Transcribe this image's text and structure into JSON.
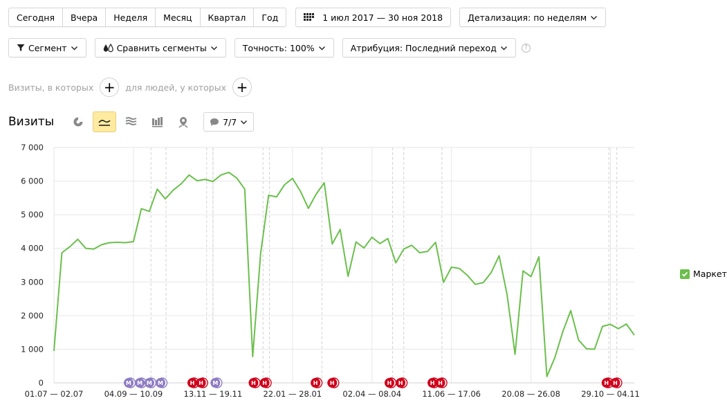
{
  "periods": [
    "Сегодня",
    "Вчера",
    "Неделя",
    "Месяц",
    "Квартал",
    "Год"
  ],
  "date_range": "1 июл 2017 — 30 ноя 2018",
  "detail": "Детализация: по неделям",
  "segment": "Сегмент",
  "compare": "Сравнить сегменты",
  "accuracy": "Точность: 100%",
  "attribution": "Атрибуция: Последний переход",
  "help_mark": "?",
  "filter": {
    "visits_where": "Визиты, в которых",
    "people_where": "для людей, у которых",
    "plus": "+"
  },
  "chart_header": {
    "title": "Визиты",
    "annotations": "7/7"
  },
  "legend": {
    "label": "Маркет",
    "color": "#6abf4b"
  },
  "chart_data": {
    "type": "line",
    "ylim": [
      0,
      7000
    ],
    "y_ticks": [
      "7 000",
      "6 000",
      "5 000",
      "4 000",
      "3 000",
      "2 000",
      "1 000",
      "0"
    ],
    "x_tick_labels": [
      "01.07 — 02.07",
      "04.09 — 10.09",
      "13.11 — 19.11",
      "22.01 — 28.01",
      "02.04 — 08.04",
      "11.06 — 17.06",
      "20.08 — 26.08",
      "29.10 — 04.11"
    ],
    "x_tick_index": [
      0,
      10,
      20,
      30,
      40,
      50,
      60,
      70
    ],
    "series": [
      {
        "name": "Маркет",
        "color": "#6abf4b",
        "values": [
          950,
          3870,
          4050,
          4270,
          4000,
          3980,
          4110,
          4170,
          4180,
          4170,
          4200,
          5180,
          5100,
          5760,
          5470,
          5730,
          5920,
          6180,
          6010,
          6050,
          5990,
          6180,
          6260,
          6090,
          5760,
          780,
          3850,
          5580,
          5530,
          5890,
          6080,
          5700,
          5190,
          5620,
          5950,
          4130,
          4560,
          3170,
          4190,
          4010,
          4330,
          4140,
          4290,
          3570,
          3980,
          4090,
          3870,
          3910,
          4180,
          2990,
          3440,
          3400,
          3200,
          2930,
          2980,
          3280,
          3780,
          2620,
          850,
          3330,
          3160,
          3750,
          190,
          750,
          1520,
          2150,
          1270,
          1010,
          1000,
          1680,
          1740,
          1610,
          1750,
          1420
        ]
      }
    ],
    "annotations": [
      {
        "label": "М",
        "color": "#8e7cc3",
        "index": 9.4
      },
      {
        "label": "М",
        "color": "#8e7cc3",
        "index": 10.8
      },
      {
        "label": "М",
        "color": "#8e7cc3",
        "index": 12.0
      },
      {
        "label": "М",
        "color": "#8e7cc3",
        "index": 13.4
      },
      {
        "label": "Н",
        "color": "#d0021b",
        "index": 17.4
      },
      {
        "label": "Н",
        "color": "#d0021b",
        "index": 18.5
      },
      {
        "label": "М",
        "color": "#8e7cc3",
        "index": 20.3
      },
      {
        "label": "Н",
        "color": "#d0021b",
        "index": 25.1
      },
      {
        "label": "Н",
        "color": "#d0021b",
        "index": 26.5
      },
      {
        "label": "Н",
        "color": "#d0021b",
        "index": 32.9
      },
      {
        "label": "Н",
        "color": "#d0021b",
        "index": 35.0
      },
      {
        "label": "Н",
        "color": "#d0021b",
        "index": 42.2
      },
      {
        "label": "Н",
        "color": "#d0021b",
        "index": 43.6
      },
      {
        "label": "Н",
        "color": "#d0021b",
        "index": 47.6
      },
      {
        "label": "Н",
        "color": "#d0021b",
        "index": 48.6
      },
      {
        "label": "Н",
        "color": "#d0021b",
        "index": 69.5
      },
      {
        "label": "Н",
        "color": "#d0021b",
        "index": 70.6
      }
    ],
    "annotation_lines": [
      12.2,
      14.1,
      19.2,
      20.0,
      26.3,
      27.1,
      33.7,
      42.6,
      44.0,
      48.8,
      69.8,
      70.8
    ]
  }
}
